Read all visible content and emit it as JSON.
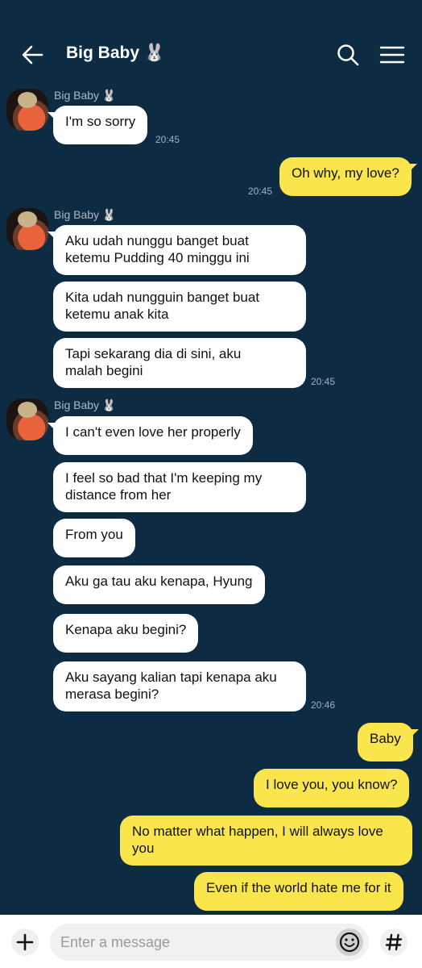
{
  "header": {
    "title": "Big Baby 🐰",
    "back_icon": "back-arrow-icon",
    "search_icon": "search-icon",
    "menu_icon": "hamburger-menu-icon"
  },
  "messages": [
    {
      "sender": "Big Baby 🐰",
      "text": "I'm so sorry",
      "time": "20:45"
    },
    {
      "text": "Oh why, my love?",
      "time": "20:45"
    },
    {
      "sender": "Big Baby 🐰"
    },
    {
      "text": "Aku udah nunggu banget buat\nketemu Pudding 40 minggu ini"
    },
    {
      "text": "Kita udah nungguin banget buat\nketemu anak kita"
    },
    {
      "text": "Tapi sekarang dia di sini, aku\nmalah begini",
      "time": "20:45"
    },
    {
      "sender": "Big Baby 🐰"
    },
    {
      "text": "I can't even love her properly"
    },
    {
      "text": "I feel so bad that I'm keeping my\ndistance from her"
    },
    {
      "text": "From you"
    },
    {
      "text": "Aku ga tau aku kenapa, Hyung"
    },
    {
      "text": "Kenapa aku begini?"
    },
    {
      "text": "Aku sayang kalian tapi kenapa aku\nmerasa begini?",
      "time": "20:46"
    },
    {
      "text": "Baby"
    },
    {
      "text": "I love you, you know?"
    },
    {
      "text": "No matter what happen, I will always love\nyou"
    },
    {
      "text": "Even if the world hate me for it"
    }
  ],
  "input": {
    "placeholder": "Enter a message",
    "plus_icon": "plus-icon",
    "emoji_icon": "emoji-icon",
    "hash_icon": "hashtag-icon"
  },
  "colors": {
    "background": "#0d2c44",
    "incoming_bubble": "#ffffff",
    "outgoing_bubble": "#fae64c"
  }
}
